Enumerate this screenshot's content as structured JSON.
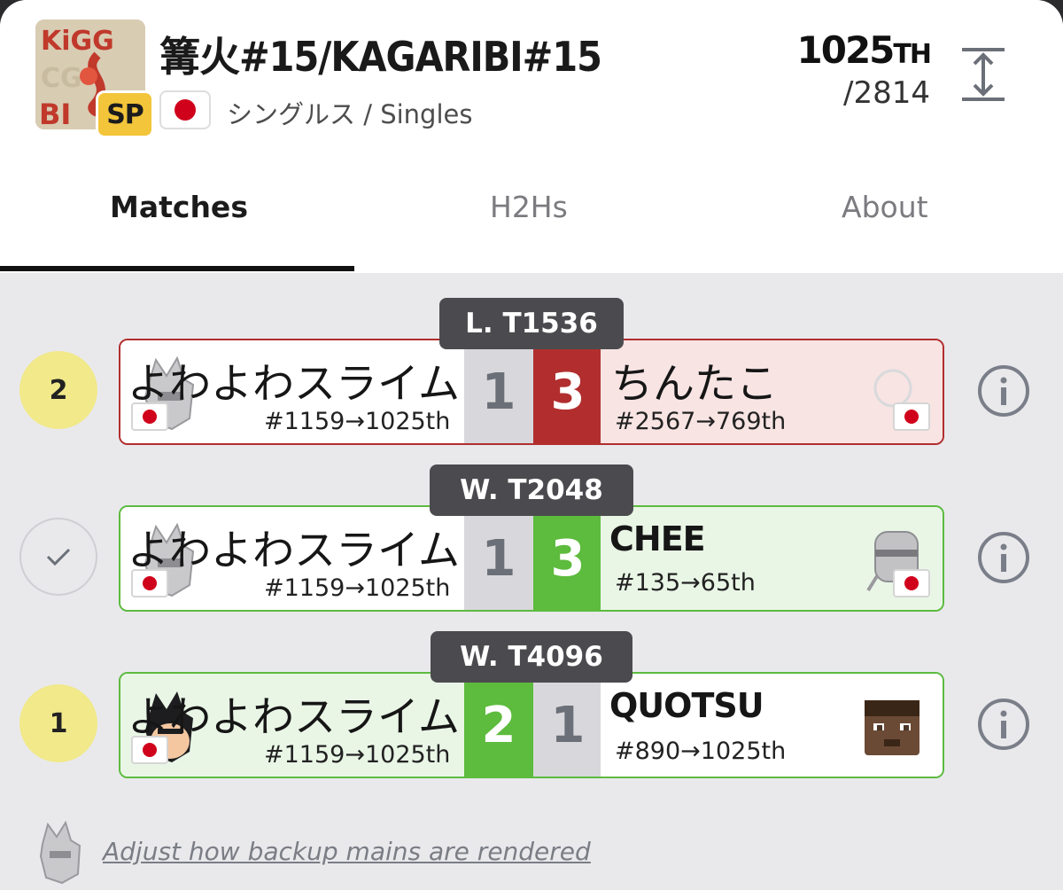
{
  "header": {
    "title": "篝火#15/KAGARIBI#15",
    "sp_badge": "SP",
    "subtitle": "シングルス / Singles",
    "rank_number": "1025",
    "rank_suffix": "TH",
    "rank_total": "/2814",
    "logo_text": "KAGARIBI",
    "accent_color": "#f3c53a",
    "flag_icon": "japan-flag-icon"
  },
  "tabs": [
    {
      "label": "Matches",
      "active": true
    },
    {
      "label": "H2Hs",
      "active": false
    },
    {
      "label": "About",
      "active": false
    }
  ],
  "matches": [
    {
      "round": "L. T1536",
      "seed": "2",
      "left": {
        "name": "よわよわスライム",
        "meta": "#1159→1025th"
      },
      "right": {
        "name": "ちんたこ",
        "meta": "#2567→769th"
      },
      "score_left": "1",
      "score_right": "3",
      "result": "loss"
    },
    {
      "round": "W. T2048",
      "seed": "",
      "left": {
        "name": "よわよわスライム",
        "meta": "#1159→1025th"
      },
      "right": {
        "name": "CHEE",
        "meta": "#135→65th"
      },
      "score_left": "1",
      "score_right": "3",
      "result": "loss"
    },
    {
      "round": "W. T4096",
      "seed": "1",
      "left": {
        "name": "よわよわスライム",
        "meta": "#1159→1025th"
      },
      "right": {
        "name": "QUOTSU",
        "meta": "#890→1025th"
      },
      "score_left": "2",
      "score_right": "1",
      "result": "win"
    }
  ],
  "footer": {
    "link_text": "Adjust how backup mains are rendered"
  },
  "colors": {
    "loss_red": "#b22e2e",
    "win_green": "#5dbb3d",
    "seed_yellow": "#f1e98a"
  }
}
